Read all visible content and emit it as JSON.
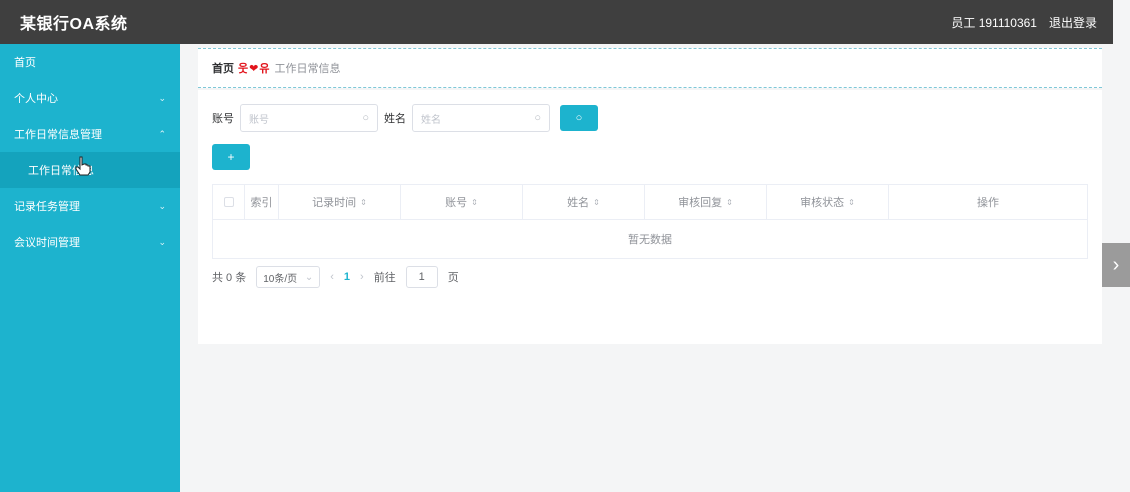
{
  "header": {
    "title": "某银行OA系统",
    "user": "员工 191110361",
    "logout": "退出登录"
  },
  "sidebar": {
    "items": [
      {
        "label": "首页"
      },
      {
        "label": "个人中心",
        "chevron": "⌄"
      },
      {
        "label": "工作日常信息管理",
        "chevron": "⌃"
      },
      {
        "label": "工作日常信息"
      },
      {
        "label": "记录任务管理",
        "chevron": "⌄"
      },
      {
        "label": "会议时间管理",
        "chevron": "⌄"
      }
    ]
  },
  "breadcrumb": {
    "home": "首页",
    "separator": "웃❤유",
    "current": "工作日常信息"
  },
  "search": {
    "account_label": "账号",
    "account_placeholder": "账号",
    "name_label": "姓名",
    "name_placeholder": "姓名",
    "search_icon": "○",
    "add_label": "+"
  },
  "table": {
    "columns": [
      {
        "label": "索引"
      },
      {
        "label": "记录时间",
        "sortable": true
      },
      {
        "label": "账号",
        "sortable": true
      },
      {
        "label": "姓名",
        "sortable": true
      },
      {
        "label": "审核回复",
        "sortable": true
      },
      {
        "label": "审核状态",
        "sortable": true
      },
      {
        "label": "操作"
      }
    ],
    "sort_icon": "⇕",
    "empty_text": "暂无数据"
  },
  "pagination": {
    "total": "共 0 条",
    "page_size": "10条/页",
    "dropdown_icon": "⌄",
    "prev": "‹",
    "current_page": "1",
    "next": "›",
    "goto_label": "前往",
    "goto_value": "1",
    "page_suffix": "页"
  },
  "carousel": {
    "next": "›"
  },
  "colors": {
    "accent": "#1db3ce",
    "topbar": "#3f3f3f",
    "heart": "#e2131b"
  }
}
